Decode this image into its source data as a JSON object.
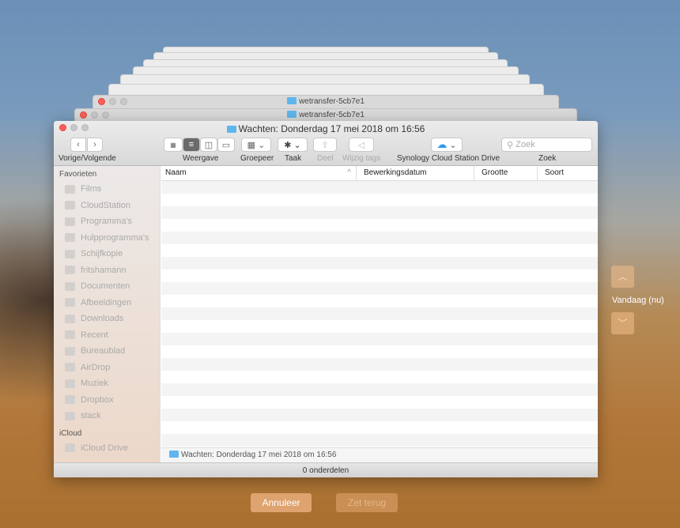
{
  "window": {
    "title": "Wachten: Donderdag 17 mei 2018 om 16:56"
  },
  "stack_windows": [
    {
      "title": "wetransfer-5cb7e1"
    },
    {
      "title": "wetransfer-5cb7e1"
    }
  ],
  "toolbar": {
    "nav_label": "Vorige/Volgende",
    "view_label": "Weergave",
    "group_label": "Groepeer",
    "action_label": "Taak",
    "share_label": "Deel",
    "tags_label": "Wijzig tags",
    "cloud_label": "Synology Cloud Station Drive",
    "search_label": "Zoek",
    "search_placeholder": "Zoek"
  },
  "sidebar": {
    "favorites_header": "Favorieten",
    "items": [
      {
        "label": "Films",
        "icon": "film-icon"
      },
      {
        "label": "CloudStation",
        "icon": "folder-icon"
      },
      {
        "label": "Programma's",
        "icon": "apps-icon"
      },
      {
        "label": "Hulpprogramma's",
        "icon": "folder-icon"
      },
      {
        "label": "Schijfkopie",
        "icon": "gear-icon"
      },
      {
        "label": "fritshamann",
        "icon": "home-icon"
      },
      {
        "label": "Documenten",
        "icon": "document-icon"
      },
      {
        "label": "Afbeeldingen",
        "icon": "camera-icon"
      },
      {
        "label": "Downloads",
        "icon": "download-icon"
      },
      {
        "label": "Recent",
        "icon": "recent-icon"
      },
      {
        "label": "Bureaublad",
        "icon": "desktop-icon"
      },
      {
        "label": "AirDrop",
        "icon": "airdrop-icon"
      },
      {
        "label": "Muziek",
        "icon": "music-icon"
      },
      {
        "label": "Dropbox",
        "icon": "folder-icon"
      },
      {
        "label": "stack",
        "icon": "folder-icon"
      }
    ],
    "icloud_header": "iCloud",
    "icloud_items": [
      {
        "label": "iCloud Drive",
        "icon": "cloud-icon"
      }
    ]
  },
  "columns": [
    "Naam",
    "Bewerkingsdatum",
    "Grootte",
    "Soort"
  ],
  "path_bar": "Wachten: Donderdag 17 mei 2018 om 16:56",
  "status": "0 onderdelen",
  "timeline": {
    "label": "Vandaag (nu)"
  },
  "buttons": {
    "cancel": "Annuleer",
    "restore": "Zet terug"
  }
}
